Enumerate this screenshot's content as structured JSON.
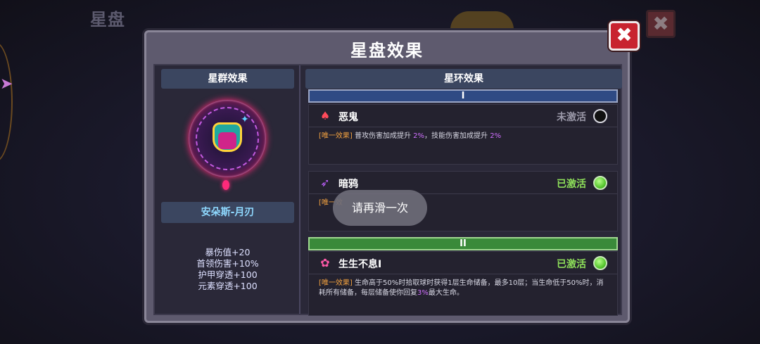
{
  "background": {
    "title": "星盘",
    "close_glyph": "✖",
    "side_arrow_glyph": "➤"
  },
  "modal": {
    "title": "星盘效果",
    "close_glyph": "✖",
    "left": {
      "header": "星群效果",
      "hero_name": "安朵斯-月刃",
      "stats": [
        "暴伤值+20",
        "首领伤害+10%",
        "护甲穿透+100",
        "元素穿透+100"
      ]
    },
    "right": {
      "header": "星环效果",
      "tiers": [
        {
          "label": "I",
          "color": "#2f4a84"
        },
        {
          "label": "II",
          "color": "#3a8a3a"
        }
      ],
      "effects": [
        {
          "name": "恶鬼",
          "icon": "demon-crab-icon",
          "status": "未激活",
          "active": false,
          "tag": "[唯一效果]",
          "desc_a": " 普攻伤害加成提升 ",
          "val_a": "2%",
          "desc_b": "，技能伤害加成提升 ",
          "val_b": "2%",
          "desc_c": ""
        },
        {
          "name": "暗鸦",
          "icon": "crow-icon",
          "status": "已激活",
          "active": true,
          "tag": "[唯一效",
          "desc_a": "",
          "val_a": "",
          "desc_b": "",
          "val_b": "",
          "desc_c": ""
        },
        {
          "name": "生生不息Ⅰ",
          "icon": "flower-icon",
          "status": "已激活",
          "active": true,
          "tag": "[唯一效果]",
          "desc_a": " 生命高于50%时拾取球时获得1层生命储备，最多10层；当生命低于50%时，消耗所有储备，每层储备使你回复",
          "val_a": "3%",
          "desc_b": "最大生命。",
          "val_b": "",
          "desc_c": ""
        }
      ]
    }
  },
  "toast": "请再滑一次",
  "colors": {
    "status_active": "#8ee05a",
    "status_inactive": "#9a98a8",
    "highlight": "#d070ff",
    "tag": "#f0a040",
    "close_button": "#c8232f",
    "hero_name": "#8fd9ff"
  }
}
